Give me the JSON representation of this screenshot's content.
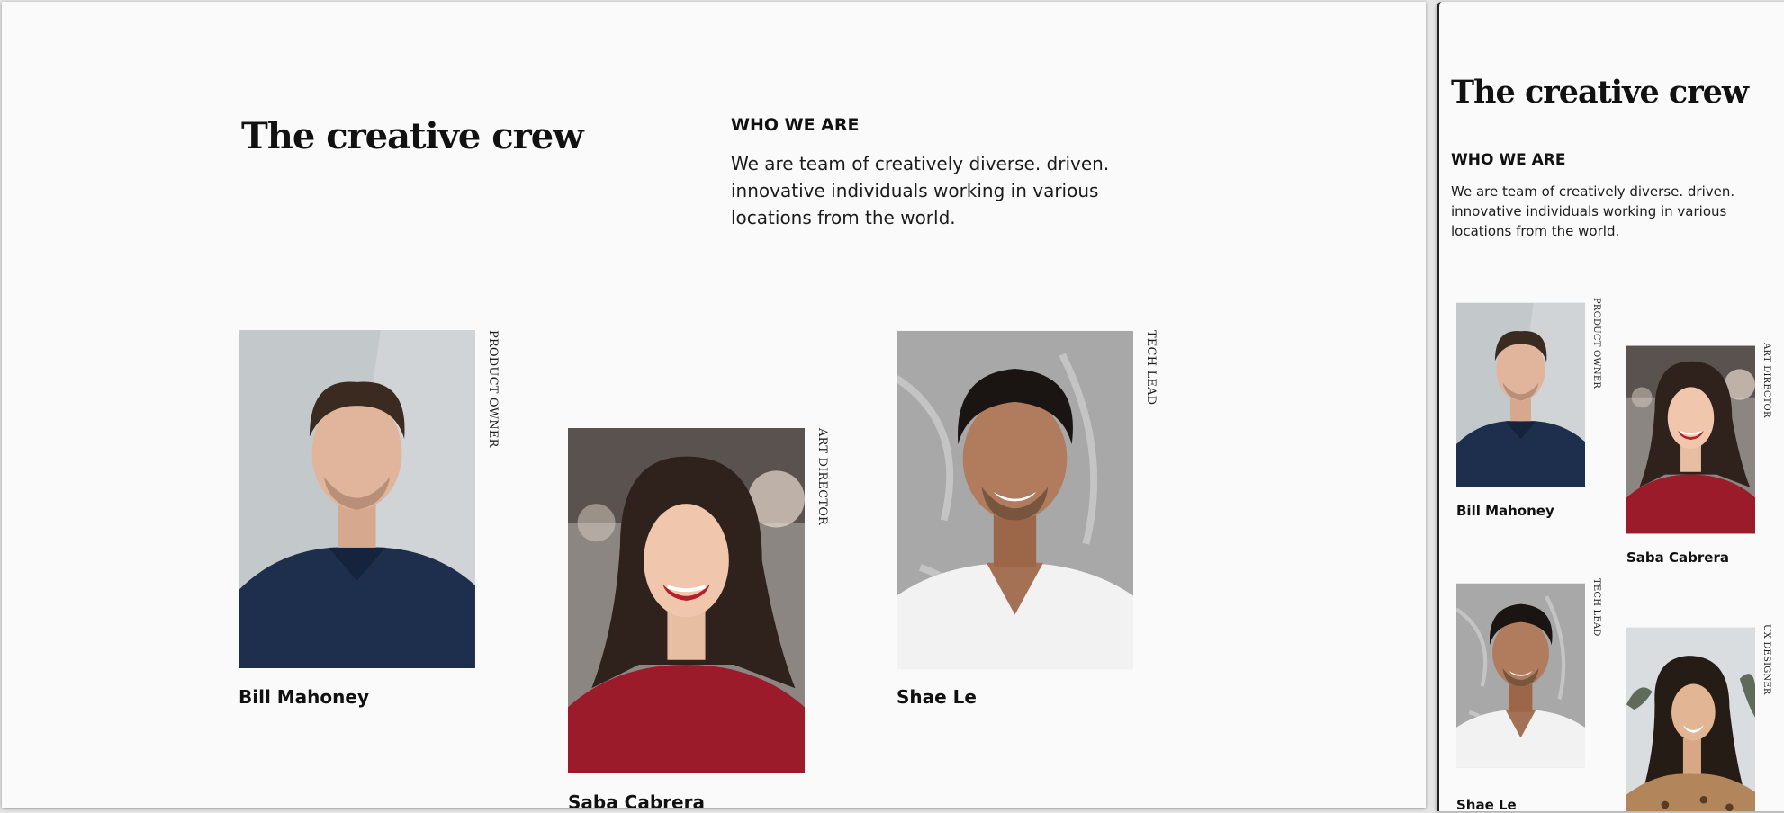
{
  "desktop": {
    "title": "The creative crew",
    "kicker": "WHO WE ARE",
    "description": "We are team of creatively diverse.  driven. innovative individuals working in various locations from the world.",
    "members": [
      {
        "name": "Bill Mahoney",
        "role": "PRODUCT OWNER"
      },
      {
        "name": "Saba Cabrera",
        "role": "ART DIRECTOR"
      },
      {
        "name": "Shae Le",
        "role": "TECH LEAD"
      }
    ]
  },
  "mobile": {
    "title": "The creative crew",
    "kicker": "WHO WE ARE",
    "description": "We are team of creatively diverse.  driven. innovative individuals working in various locations from the world.",
    "members": [
      {
        "name": "Bill Mahoney",
        "role": "PRODUCT OWNER"
      },
      {
        "name": "Saba Cabrera",
        "role": "ART DIRECTOR"
      },
      {
        "name": "Shae Le",
        "role": "TECH LEAD"
      },
      {
        "name": "",
        "role": "UX DESIGNER"
      }
    ]
  },
  "colors": {
    "page_background": "#fafafa",
    "text": "#111111",
    "bill_shirt": "#1e2f4d",
    "saba_sweater": "#9c1b2a",
    "shae_shirt": "#f2f2f2"
  }
}
